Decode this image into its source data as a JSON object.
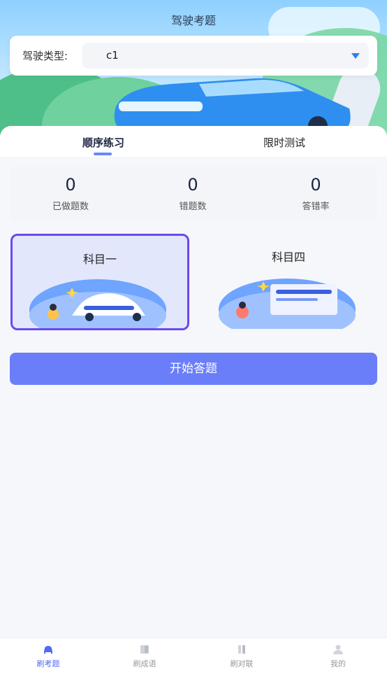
{
  "header": {
    "title": "驾驶考题"
  },
  "license_select": {
    "label": "驾驶类型:",
    "value": "c1"
  },
  "tabs": [
    {
      "label": "顺序练习",
      "active": true
    },
    {
      "label": "限时测试",
      "active": false
    }
  ],
  "stats": [
    {
      "value": "0",
      "label": "已做题数"
    },
    {
      "value": "0",
      "label": "错题数"
    },
    {
      "value": "0",
      "label": "答错率"
    }
  ],
  "subjects": [
    {
      "title": "科目一",
      "selected": true
    },
    {
      "title": "科目四",
      "selected": false
    }
  ],
  "start_button": {
    "label": "开始答题"
  },
  "bottom_nav": [
    {
      "label": "刷考题",
      "icon": "car-icon",
      "active": true
    },
    {
      "label": "刷成语",
      "icon": "book-icon",
      "active": false
    },
    {
      "label": "刷对联",
      "icon": "scroll-icon",
      "active": false
    },
    {
      "label": "我的",
      "icon": "person-icon",
      "active": false
    }
  ],
  "colors": {
    "accent": "#6a7ef9",
    "selected_border": "#6a48f2",
    "nav_active": "#4f6cf0"
  }
}
